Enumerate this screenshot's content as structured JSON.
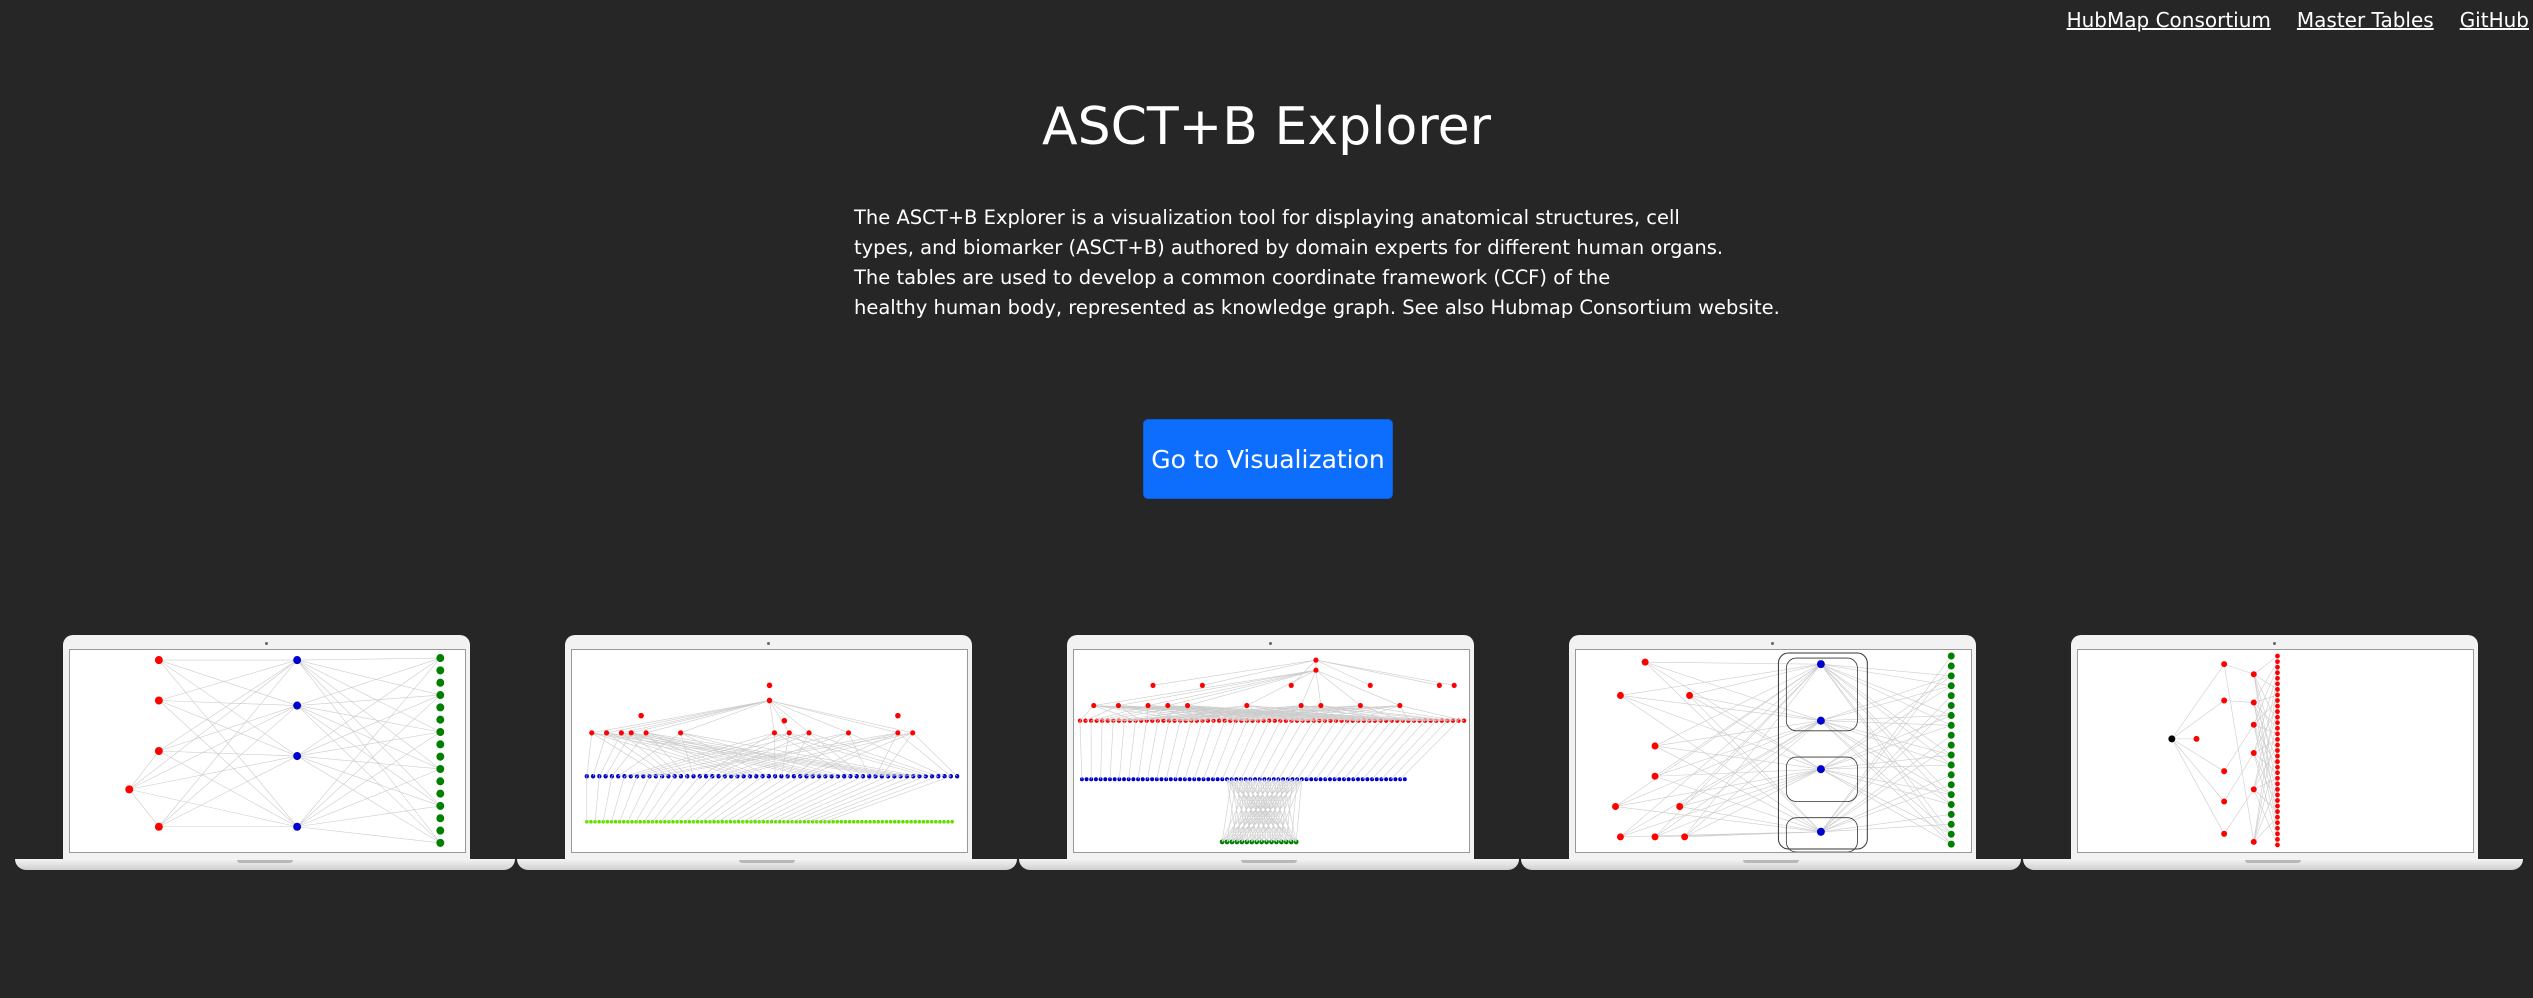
{
  "nav": {
    "links": [
      {
        "label": "HubMap Consortium"
      },
      {
        "label": "Master Tables"
      },
      {
        "label": "GitHub"
      }
    ]
  },
  "hero": {
    "title": "ASCT+B Explorer",
    "description_lines": [
      "The ASCT+B Explorer is a visualization tool for displaying anatomical structures, cell",
      "types, and biomarker (ASCT+B) authored by domain experts for different human organs.",
      "The tables are used to develop a common coordinate framework (CCF) of the",
      "healthy human body, represented as knowledge graph. See also Hubmap Consortium website."
    ],
    "cta_label": "Go to Visualization"
  },
  "colors": {
    "background": "#262626",
    "primary_button": "#0d6efd",
    "node_red": "#ff0000",
    "node_blue": "#0000cc",
    "node_green": "#008000",
    "node_lightgreen": "#66dd00"
  },
  "gallery": {
    "previews": [
      {
        "name": "laptop-preview-1",
        "style": "three-column-graph"
      },
      {
        "name": "laptop-preview-2",
        "style": "tree-with-biomarker-row"
      },
      {
        "name": "laptop-preview-3",
        "style": "dense-tree"
      },
      {
        "name": "laptop-preview-4",
        "style": "grouped-graph"
      },
      {
        "name": "laptop-preview-5",
        "style": "radial-tree"
      }
    ]
  }
}
